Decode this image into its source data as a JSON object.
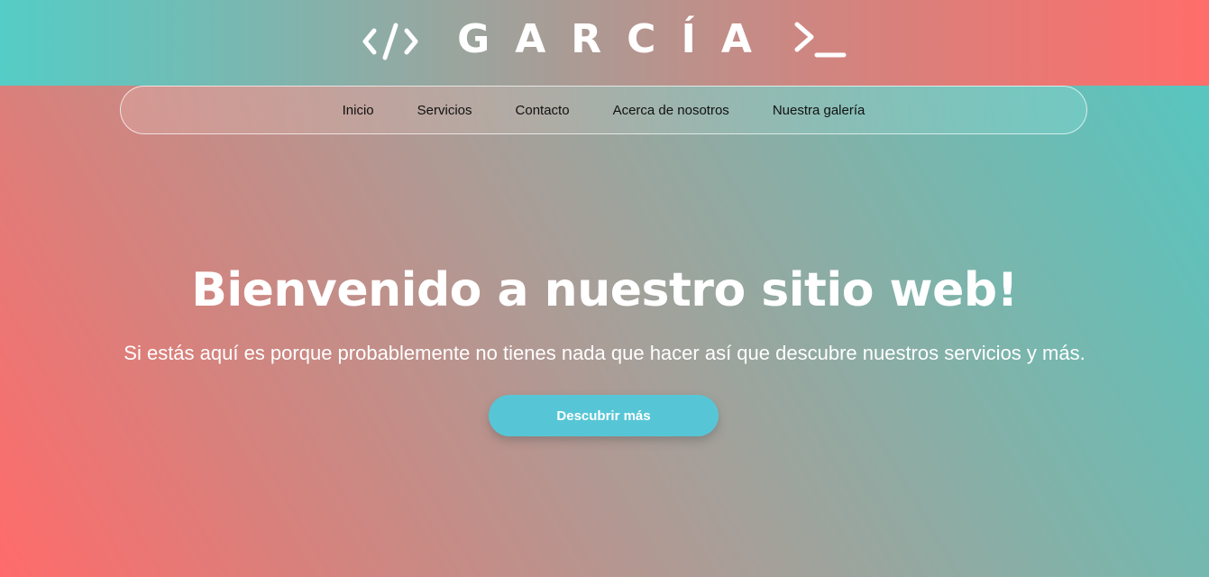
{
  "header": {
    "brand_name": "GARCÍA",
    "left_icon": "code-brackets-icon",
    "right_icon": "terminal-prompt-icon"
  },
  "nav": {
    "items": [
      {
        "label": "Inicio"
      },
      {
        "label": "Servicios"
      },
      {
        "label": "Contacto"
      },
      {
        "label": "Acerca de nosotros"
      },
      {
        "label": "Nuestra galería"
      }
    ]
  },
  "hero": {
    "title": "Bienvenido a nuestro sitio web!",
    "subtitle": "Si estás aquí es porque probablemente no tienes nada que hacer así que descubre nuestros servicios y más.",
    "cta_label": "Descubrir más"
  },
  "colors": {
    "header_gradient": [
      "#54cdc6",
      "#ff6d6a"
    ],
    "body_gradient": [
      "#ff6b6b",
      "#52c8c2"
    ],
    "cta_background": "#56c6d6",
    "text": "#ffffff"
  }
}
